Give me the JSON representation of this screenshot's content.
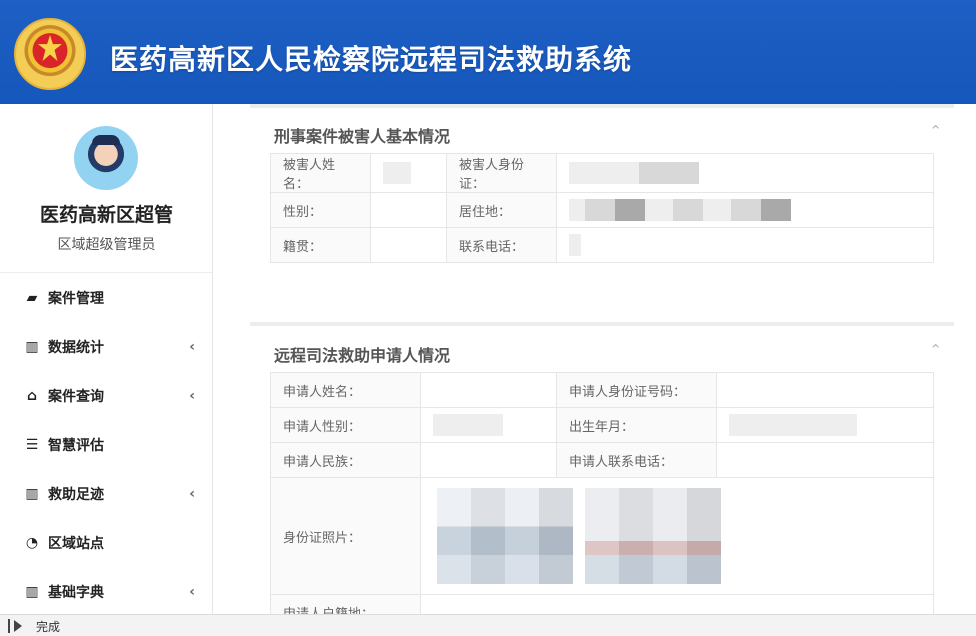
{
  "header": {
    "title": "医药高新区人民检察院远程司法救助系统",
    "emblem": "emblem-icon"
  },
  "sidebar": {
    "user_name": "医药高新区超管",
    "user_role": "区域超级管理员",
    "items": [
      {
        "label": "案件管理",
        "icon": "book-icon",
        "has_chevron": false
      },
      {
        "label": "数据统计",
        "icon": "map-icon",
        "has_chevron": true
      },
      {
        "label": "案件查询",
        "icon": "home-icon",
        "has_chevron": true
      },
      {
        "label": "智慧评估",
        "icon": "list-icon",
        "has_chevron": false
      },
      {
        "label": "救助足迹",
        "icon": "map-icon",
        "has_chevron": true
      },
      {
        "label": "区域站点",
        "icon": "dashboard-icon",
        "has_chevron": false
      },
      {
        "label": "基础字典",
        "icon": "map-icon",
        "has_chevron": true
      }
    ]
  },
  "victim_section": {
    "title": "刑事案件被害人基本情况",
    "rows": [
      [
        "被害人姓名：",
        "",
        "被害人身份证：",
        ""
      ],
      [
        "性别：",
        "",
        "居住地：",
        ""
      ],
      [
        "籍贯：",
        "",
        "联系电话：",
        ""
      ]
    ]
  },
  "applicant_section": {
    "title": "远程司法救助申请人情况",
    "rows": [
      [
        "申请人姓名：",
        "",
        "申请人身份证号码：",
        ""
      ],
      [
        "申请人性别：",
        "",
        "出生年月：",
        ""
      ],
      [
        "申请人民族：",
        "",
        "申请人联系电话：",
        ""
      ],
      [
        "身份证照片：",
        "",
        "",
        ""
      ],
      [
        "申请人户籍地：",
        "",
        "",
        ""
      ]
    ]
  },
  "statusbar": {
    "text": "完成"
  }
}
